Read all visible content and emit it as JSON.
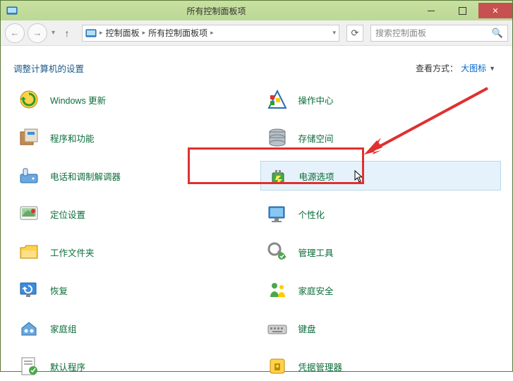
{
  "titlebar": {
    "title": "所有控制面板项"
  },
  "breadcrumb": {
    "seg1": "控制面板",
    "seg2": "所有控制面板项"
  },
  "search": {
    "placeholder": "搜索控制面板"
  },
  "header": {
    "title": "调整计算机的设置",
    "view_label": "查看方式：",
    "view_value": "大图标"
  },
  "items_left": [
    {
      "label": "Windows 更新",
      "icon": "windows-update-icon"
    },
    {
      "label": "程序和功能",
      "icon": "programs-icon"
    },
    {
      "label": "电话和调制解调器",
      "icon": "phone-modem-icon"
    },
    {
      "label": "定位设置",
      "icon": "location-icon"
    },
    {
      "label": "工作文件夹",
      "icon": "work-folders-icon"
    },
    {
      "label": "恢复",
      "icon": "recovery-icon"
    },
    {
      "label": "家庭组",
      "icon": "homegroup-icon"
    },
    {
      "label": "默认程序",
      "icon": "default-programs-icon"
    }
  ],
  "items_right": [
    {
      "label": "操作中心",
      "icon": "action-center-icon"
    },
    {
      "label": "存储空间",
      "icon": "storage-icon"
    },
    {
      "label": "电源选项",
      "icon": "power-options-icon",
      "highlight": true
    },
    {
      "label": "个性化",
      "icon": "personalization-icon"
    },
    {
      "label": "管理工具",
      "icon": "admin-tools-icon"
    },
    {
      "label": "家庭安全",
      "icon": "family-safety-icon"
    },
    {
      "label": "键盘",
      "icon": "keyboard-icon"
    },
    {
      "label": "凭据管理器",
      "icon": "credential-manager-icon"
    }
  ]
}
